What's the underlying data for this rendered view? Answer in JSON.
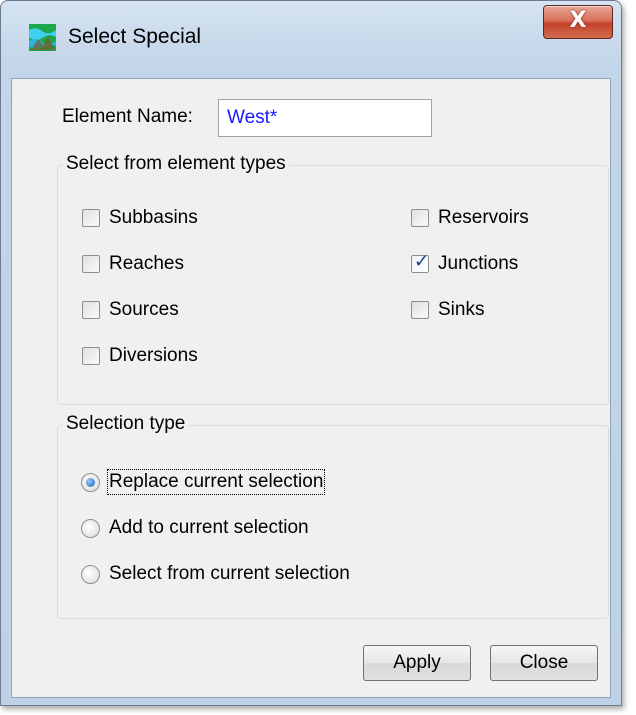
{
  "window": {
    "title": "Select Special",
    "close_glyph": "X",
    "app_icon": "hec-hms-icon"
  },
  "element_name": {
    "label": "Element Name:",
    "value": "West*"
  },
  "element_types": {
    "title": "Select from element types",
    "items": [
      {
        "label": "Subbasins",
        "checked": false
      },
      {
        "label": "Reaches",
        "checked": false
      },
      {
        "label": "Sources",
        "checked": false
      },
      {
        "label": "Diversions",
        "checked": false
      },
      {
        "label": "Reservoirs",
        "checked": false
      },
      {
        "label": "Junctions",
        "checked": true
      },
      {
        "label": "Sinks",
        "checked": false
      }
    ]
  },
  "selection_type": {
    "title": "Selection type",
    "options": [
      {
        "label": "Replace current selection",
        "selected": true
      },
      {
        "label": "Add to current selection",
        "selected": false
      },
      {
        "label": "Select from current selection",
        "selected": false
      }
    ]
  },
  "buttons": {
    "apply": "Apply",
    "close": "Close"
  }
}
